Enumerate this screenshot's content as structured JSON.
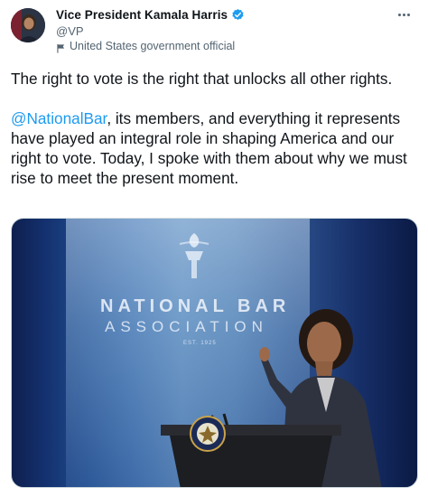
{
  "author": {
    "display_name": "Vice President Kamala Harris",
    "handle": "@VP",
    "label": "United States government official"
  },
  "icons": {
    "verified": "verified-badge-icon",
    "label": "flag-icon",
    "more": "more-options-icon"
  },
  "tweet": {
    "paragraph1": "The right to vote is the right that unlocks all other rights.",
    "mention": "@NationalBar",
    "paragraph2_rest": ", its members, and everything it represents have played an integral role in shaping America and our right to vote. Today, I spoke with them about why we must rise to meet the present moment."
  },
  "photo": {
    "banner_line1": "NATIONAL BAR",
    "banner_line2": "ASSOCIATION",
    "banner_est": "EST. 1925"
  },
  "colors": {
    "accent": "#1d9bf0",
    "text": "#0f1419",
    "secondary": "#536471"
  }
}
